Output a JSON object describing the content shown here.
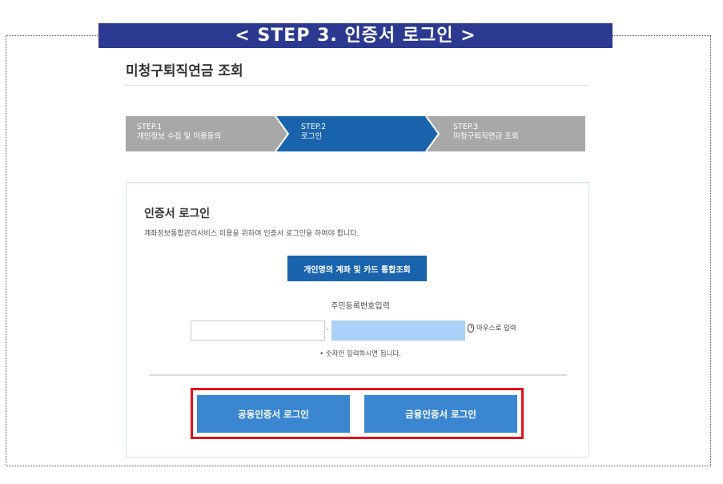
{
  "banner": {
    "title": "< STEP 3. 인증서 로그인 >"
  },
  "page": {
    "title": "미청구퇴직연금 조회"
  },
  "steps": [
    {
      "num": "STEP.1",
      "label": "개인정보 수집 및 이용동의",
      "state": "inactive"
    },
    {
      "num": "STEP.2",
      "label": "로그인",
      "state": "active"
    },
    {
      "num": "STEP.3",
      "label": "미청구퇴직연금 조회",
      "state": "inactive"
    }
  ],
  "login": {
    "title": "인증서 로그인",
    "description": "계좌정보통합관리서비스 이용을 위하여 인증서 로그인을 하여야 합니다.",
    "integrated_button": "개인명의 계좌 및 카드 통합조회",
    "rrn_label": "주민등록번호입력",
    "rrn_first_value": "",
    "rrn_second_value": "",
    "rrn_separator": "-",
    "mouse_input_label": "마우스로 입력",
    "note": "• 숫자만 입력하시면 됩니다.",
    "joint_cert_button": "공동인증서 로그인",
    "financial_cert_button": "금융인증서 로그인"
  },
  "colors": {
    "banner": "#2b3990",
    "step_active": "#1a64ad",
    "step_inactive": "#a8a8a8",
    "cert_button": "#3a86d1",
    "highlight": "#e0111b",
    "rrn_second_fill": "#aad1f7"
  },
  "icons": {
    "mouse": "mouse-icon"
  }
}
